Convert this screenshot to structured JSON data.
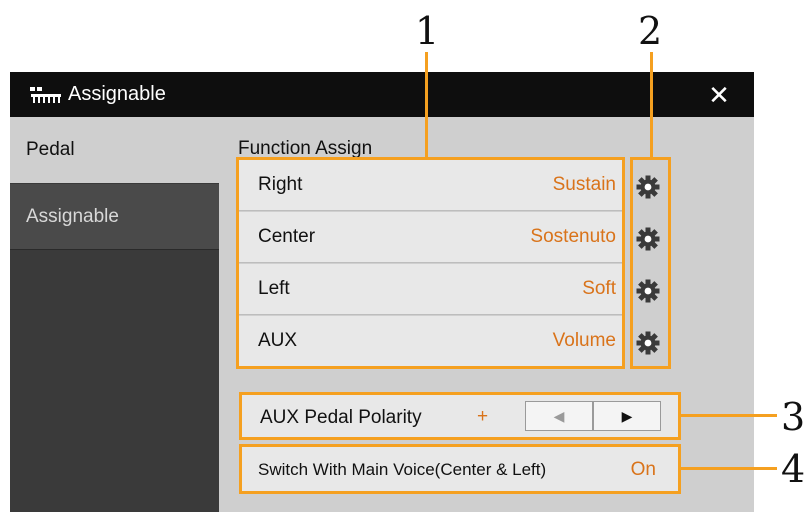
{
  "callouts": [
    "1",
    "2",
    "3",
    "4"
  ],
  "window": {
    "title": "Assignable",
    "close_symbol": "✕",
    "title_icon": "pedal-keyboard-icon"
  },
  "sidebar": {
    "tabs": [
      {
        "label": "Pedal",
        "active": true
      },
      {
        "label": "Assignable",
        "active": false
      }
    ]
  },
  "function_assign": {
    "title": "Function Assign",
    "rows": [
      {
        "label": "Right",
        "value": "Sustain"
      },
      {
        "label": "Center",
        "value": "Sostenuto"
      },
      {
        "label": "Left",
        "value": "Soft"
      },
      {
        "label": "AUX",
        "value": "Volume"
      }
    ],
    "settings_icon": "gear-icon"
  },
  "aux_polarity": {
    "label": "AUX Pedal Polarity",
    "value": "+",
    "left_arrow": "◀",
    "right_arrow": "▶"
  },
  "switch_main_voice": {
    "label": "Switch With Main Voice(Center & Left)",
    "value": "On"
  },
  "colors": {
    "accent": "#d9731a",
    "callout_frame": "#f5a020",
    "titlebar": "#0e0e0e",
    "panel": "#cfcfcf",
    "sidebar": "#3a3a3a"
  }
}
